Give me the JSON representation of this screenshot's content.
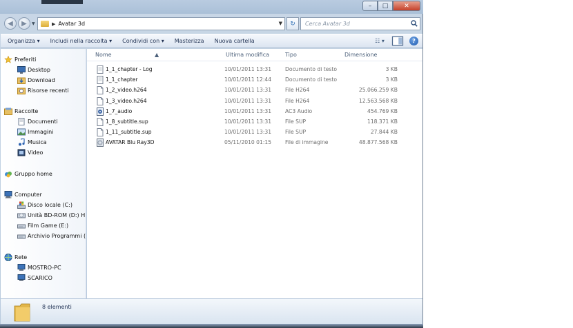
{
  "window": {
    "title": "",
    "buttons": {
      "minimize": "–",
      "maximize": "□",
      "close": "✕"
    }
  },
  "address": {
    "path": [
      "Avatar 3d"
    ],
    "search_placeholder": "Cerca Avatar 3d",
    "refresh_glyph": "↻"
  },
  "toolbar": {
    "items": [
      "Organizza ▾",
      "Includi nella raccolta ▾",
      "Condividi con ▾",
      "Masterizza",
      "Nuova cartella"
    ],
    "view_glyph": "☷ ▾",
    "help_glyph": "?"
  },
  "nav": {
    "favorites": {
      "label": "Preferiti",
      "items": [
        "Desktop",
        "Download",
        "Risorse recenti"
      ]
    },
    "libraries": {
      "label": "Raccolte",
      "items": [
        "Documenti",
        "Immagini",
        "Musica",
        "Video"
      ]
    },
    "homegroup": {
      "label": "Gruppo home"
    },
    "computer": {
      "label": "Computer",
      "items": [
        "Disco locale (C:)",
        "Unità BD-ROM (D:) HD",
        "Film Game (E:)",
        "Archivio Programmi (F:)"
      ]
    },
    "network": {
      "label": "Rete",
      "items": [
        "MOSTRO-PC",
        "SCARICO"
      ]
    }
  },
  "columns": {
    "name": "Nome",
    "modified": "Ultima modifica",
    "type": "Tipo",
    "size": "Dimensione"
  },
  "files": [
    {
      "name": "1_1_chapter - Log",
      "modified": "10/01/2011 13:31",
      "type": "Documento di testo",
      "size": "3 KB",
      "icon": "text-file-icon"
    },
    {
      "name": "1_1_chapter",
      "modified": "10/01/2011 12:44",
      "type": "Documento di testo",
      "size": "3 KB",
      "icon": "text-file-icon"
    },
    {
      "name": "1_2_video.h264",
      "modified": "10/01/2011 13:31",
      "type": "File H264",
      "size": "25.066.259 KB",
      "icon": "generic-file-icon"
    },
    {
      "name": "1_3_video.h264",
      "modified": "10/01/2011 13:31",
      "type": "File H264",
      "size": "12.563.568 KB",
      "icon": "generic-file-icon"
    },
    {
      "name": "1_7_audio",
      "modified": "10/01/2011 13:31",
      "type": "AC3 Audio",
      "size": "454.769 KB",
      "icon": "audio-file-icon"
    },
    {
      "name": "1_8_subtitle.sup",
      "modified": "10/01/2011 13:31",
      "type": "File SUP",
      "size": "118.371 KB",
      "icon": "generic-file-icon"
    },
    {
      "name": "1_11_subtitle.sup",
      "modified": "10/01/2011 13:31",
      "type": "File SUP",
      "size": "27.844 KB",
      "icon": "generic-file-icon"
    },
    {
      "name": "AVATAR Blu Ray3D",
      "modified": "05/11/2010 01:15",
      "type": "File di immagine",
      "size": "48.877.568 KB",
      "icon": "disc-image-icon"
    }
  ],
  "status": {
    "count": "8 elementi"
  }
}
